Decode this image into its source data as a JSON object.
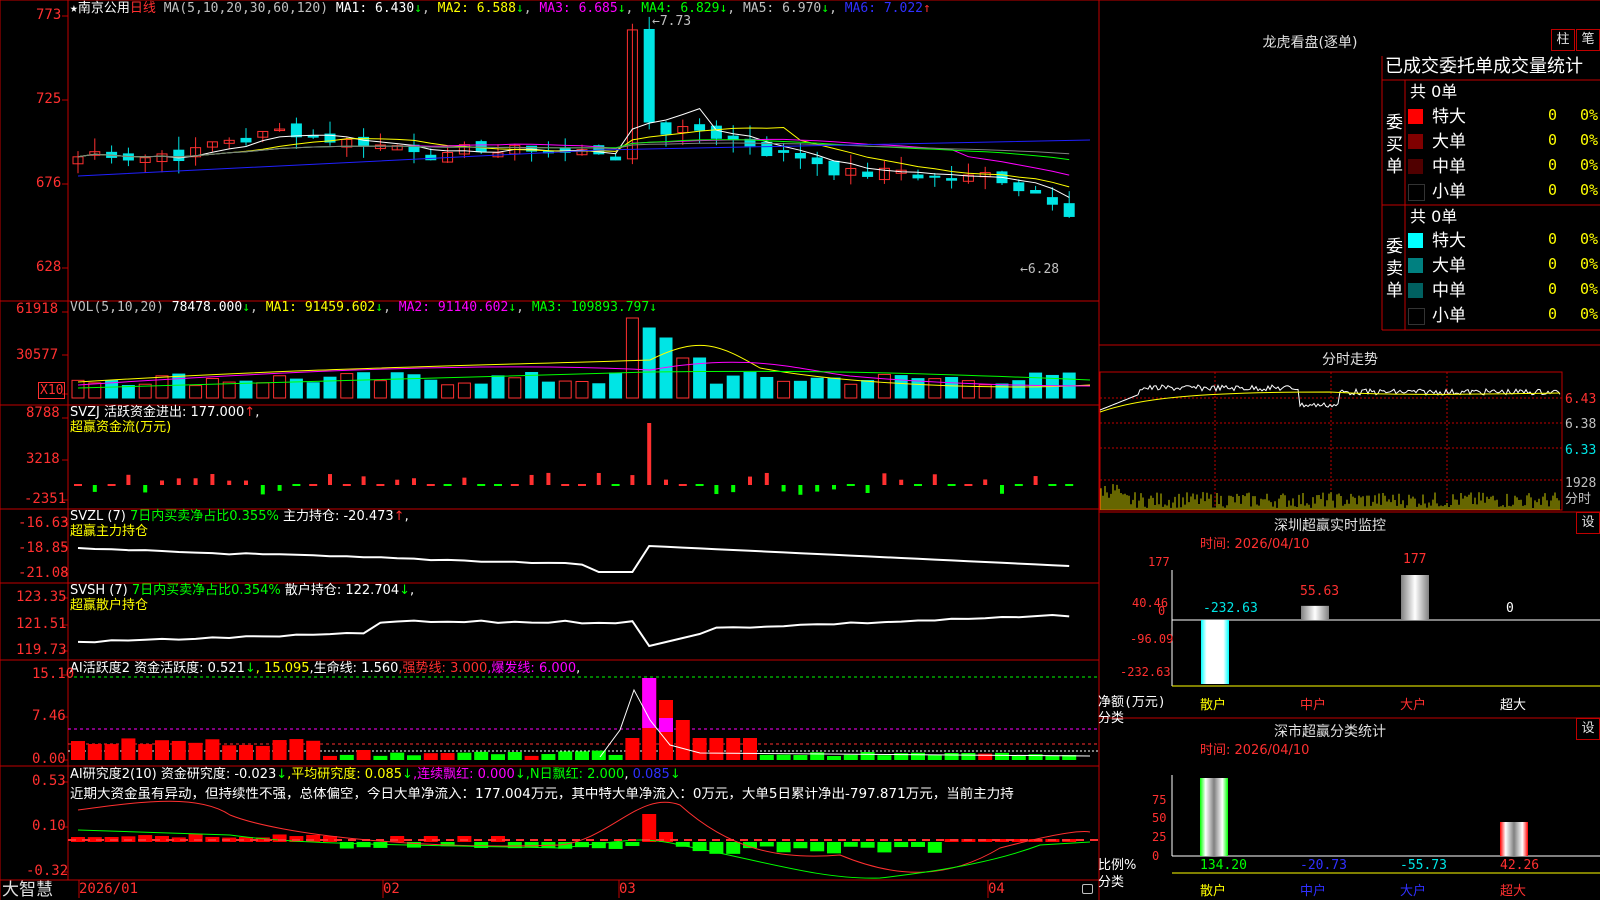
{
  "colors": {
    "up": "#ff3030",
    "down": "#00e5e5",
    "grid": "#c00000",
    "ma1": "#ffffff",
    "ma2": "#ffff00",
    "ma3": "#ff00ff",
    "ma4": "#00ff00",
    "ma5": "#808080",
    "ma6": "#0000ff",
    "green": "#00ff00",
    "yellow": "#ffff00",
    "magenta": "#ff00ff"
  },
  "main_chart": {
    "star": "★",
    "stock_name": "南京公用",
    "period": "日线",
    "ma_params": "MA(5,10,20,30,60,120)",
    "ma_values": [
      {
        "label": "MA1: ",
        "value": "6.430",
        "arrow": "↓"
      },
      {
        "label": "MA2: ",
        "value": "6.588",
        "arrow": "↓"
      },
      {
        "label": "MA3: ",
        "value": "6.685",
        "arrow": "↓"
      },
      {
        "label": "MA4: ",
        "value": "6.829",
        "arrow": "↓"
      },
      {
        "label": "MA5: ",
        "value": "6.970",
        "arrow": "↓"
      },
      {
        "label": "MA6: ",
        "value": "7.022",
        "arrow": "↑"
      }
    ],
    "y_ticks": [
      "773",
      "725",
      "676",
      "628"
    ],
    "high_label": "7.73",
    "low_label": "6.28"
  },
  "vol_panel": {
    "title": "VOL(5,10,20)",
    "value": "78478.000",
    "arrow": "↓",
    "ma1": "MA1: 91459.602",
    "ma1_arrow": "↓",
    "ma2": "MA2: 91140.602",
    "ma2_arrow": "↓",
    "ma3": "MA3: 109893.797",
    "ma3_arrow": "↓",
    "y_ticks": [
      "61918",
      "30577"
    ],
    "unit": "X10"
  },
  "svzj_panel": {
    "title": "SVZJ  活跃资金进出: 177.000",
    "arrow": "↑",
    "comma": ",",
    "subtitle": "超赢资金流(万元)",
    "y_ticks": [
      "8788",
      "3218",
      "-2351"
    ]
  },
  "svzl_panel": {
    "title": "SVZL (7)",
    "mid": "7日内买卖净占比0.355%",
    "end": "主力持仓: -20.473",
    "arrow": "↑",
    "comma": ",",
    "subtitle": "超赢主力持仓",
    "y_ticks": [
      "-16.63",
      "-18.85",
      "-21.08"
    ]
  },
  "svsh_panel": {
    "title": "SVSH (7)",
    "mid": "7日内买卖净占比0.354%",
    "end": "散户持仓: 122.704",
    "arrow": "↓",
    "comma": ",",
    "subtitle": "超赢散户持仓",
    "y_ticks": [
      "123.35",
      "121.51",
      "119.73"
    ]
  },
  "ai_active_panel": {
    "title": "AI活跃度2",
    "p1": "资金活跃度: 0.521",
    "a1": "↓",
    "p2": ", 15.095",
    "p3": ",生命线: 1.560",
    "p4": ",强势线: 3.000",
    "p5": ",爆发线: 6.000",
    "p6": ",",
    "y_ticks": [
      "15.10",
      "7.46",
      "0.00"
    ]
  },
  "ai_research_panel": {
    "title": "AI研究度2(10)",
    "p1": "资金研究度: -0.023",
    "a1": "↓",
    "p2": ",平均研究度: 0.085",
    "a2": "↓",
    "p3": ",连续飘红: 0.000",
    "a3": "↓",
    "p4": ",N日飘红: 2.000",
    "p5": ",",
    "p6": "0.085",
    "a6": "↓",
    "commentary": "近期大资金虽有异动，但持续性不强，总体偏空，今日大单净流入：177.004万元，其中特大单净流入：0万元，大单5日累计净出-797.871万元，当前主力持",
    "y_ticks": [
      "0.53",
      "0.10",
      "-0.32"
    ]
  },
  "x_axis": {
    "labels": [
      "2026/01",
      "02",
      "03",
      "04"
    ]
  },
  "footer": {
    "brand": "大智慧"
  },
  "longhu": {
    "title": "龙虎看盘(逐单)",
    "btn1": "柱",
    "btn2": "笔",
    "header": "已成交委托单成交量统计",
    "buy": {
      "total": "共 0单",
      "side_label": "委买单",
      "rows": [
        {
          "name": "特大",
          "count": "0",
          "pct": "0%",
          "color": "#ff0000"
        },
        {
          "name": "大单",
          "count": "0",
          "pct": "0%",
          "color": "#800000"
        },
        {
          "name": "中单",
          "count": "0",
          "pct": "0%",
          "color": "#500000"
        },
        {
          "name": "小单",
          "count": "0",
          "pct": "0%",
          "color": "#000000"
        }
      ]
    },
    "sell": {
      "total": "共 0单",
      "side_label": "委卖单",
      "rows": [
        {
          "name": "特大",
          "count": "0",
          "pct": "0%",
          "color": "#00ffff"
        },
        {
          "name": "大单",
          "count": "0",
          "pct": "0%",
          "color": "#008080"
        },
        {
          "name": "中单",
          "count": "0",
          "pct": "0%",
          "color": "#006060"
        },
        {
          "name": "小单",
          "count": "0",
          "pct": "0%",
          "color": "#000000"
        }
      ]
    }
  },
  "intraday": {
    "title": "分时走势",
    "y_ticks": [
      "6.43",
      "6.38",
      "6.33"
    ],
    "vol_tick": "1928",
    "vol_unit": "分时"
  },
  "sz_monitor": {
    "title": "深圳超赢实时监控",
    "btn": "设",
    "time": "时间: 2026/04/10",
    "y_ticks": [
      "177",
      "40.46",
      "0",
      "-96.09",
      "-232.63"
    ],
    "bars": [
      {
        "label": "-232.63",
        "value": -232.63
      },
      {
        "label": "55.63",
        "value": 55.63
      },
      {
        "label": "177",
        "value": 177
      },
      {
        "label": "0",
        "value": 0
      }
    ],
    "y_title": "净额(万元)",
    "x_title": "分类",
    "categories": [
      "散户",
      "中户",
      "大户",
      "超大"
    ]
  },
  "sz_class": {
    "title": "深市超赢分类统计",
    "btn": "设",
    "time": "时间: 2026/04/10",
    "y_ticks": [
      "75",
      "50",
      "25",
      "0"
    ],
    "bars": [
      {
        "label": "134.20",
        "value": 134.2
      },
      {
        "label": "-20.73",
        "value": -20.73
      },
      {
        "label": "-55.73",
        "value": -55.73
      },
      {
        "label": "42.26",
        "value": 42.26
      }
    ],
    "y_title": "比例%",
    "x_title": "分类",
    "categories": [
      "散户",
      "中户",
      "大户",
      "超大"
    ]
  }
}
